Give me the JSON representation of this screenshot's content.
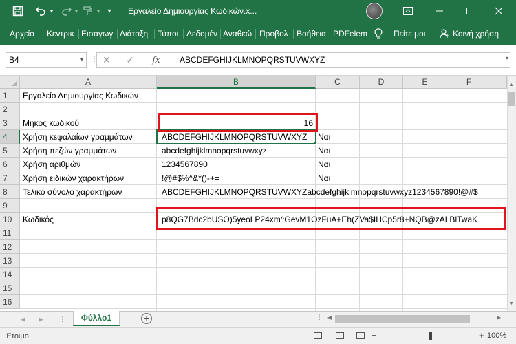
{
  "window": {
    "title": "Εργαλείο Δημιουργίας Κωδικών.x...",
    "theme_color": "#217346"
  },
  "ribbon": {
    "tabs": [
      "Αρχείο",
      "Κεντρικ",
      "Εισαγωγ",
      "Διάταξη",
      "Τύποι",
      "Δεδομέν",
      "Αναθεώ",
      "Προβολ",
      "Βοήθεια",
      "PDFelem"
    ],
    "tell_me": "Πείτε μοι",
    "share": "Κοινή χρήση"
  },
  "formula_bar": {
    "name_box": "B4",
    "fx_label": "fx",
    "content": "ABCDEFGHIJKLMNOPQRSTUVWXYZ"
  },
  "columns": [
    "A",
    "B",
    "C",
    "D",
    "E",
    "F"
  ],
  "rows": [
    "1",
    "2",
    "3",
    "4",
    "5",
    "6",
    "7",
    "8",
    "9",
    "10",
    "11",
    "12",
    "13",
    "14",
    "15",
    "16"
  ],
  "cells": {
    "A1": "Εργαλείο Δημιουργίας Κωδικών",
    "A3": "Μήκος κωδικού",
    "B3": "16",
    "A4": "Χρήση κεφαλαίων γραμμάτων",
    "B4": "ABCDEFGHIJKLMNOPQRSTUVWXYZ",
    "C4": "Ναι",
    "A5": "Χρήση πεζών γραμμάτων",
    "B5": "abcdefghijklmnopqrstuvwxyz",
    "C5": "Ναι",
    "A6": "Χρήση αριθμών",
    "B6": "1234567890",
    "C6": "Ναι",
    "A7": "Χρήση ειδικών χαρακτήρων",
    "B7": "!@#$%^&*()-+=",
    "C7": "Ναι",
    "A8": "Τελικό σύνολο χαρακτήρων",
    "B8": "ABCDEFGHIJKLMNOPQRSTUVWXYZabcdefghijklmnopqrstuvwxyz1234567890!@#$",
    "A10": "Κωδικός",
    "B10": "p8QG7Bdc2bUSO)5yeoLP24xm^GevM1OzFuA+Eh(ZVa$IHCp5r8+NQB@zALBlTwaK"
  },
  "sheet": {
    "active_tab": "Φύλλο1",
    "add_symbol": "+"
  },
  "status": {
    "ready": "Έτοιμο",
    "zoom": "100%",
    "zoom_level_percent": 100
  },
  "highlight_color": "#e0141c"
}
